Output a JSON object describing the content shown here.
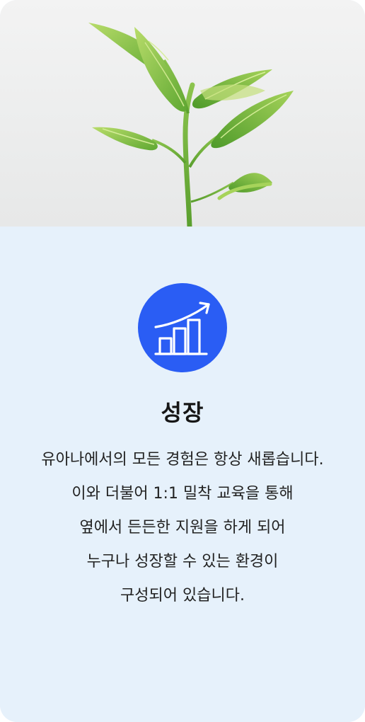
{
  "card": {
    "title": "성장",
    "description_lines": [
      "유아나에서의 모든 경험은 항상 새롭습니다.",
      "이와 더불어 1:1 밀착 교육을 통해",
      "옆에서 든든한 지원을 하게 되어",
      "누구나 성장할 수 있는 환경이",
      "구성되어 있습니다."
    ],
    "icon": "growth-chart-icon",
    "image": "plant-seedling-photo"
  },
  "colors": {
    "card_background": "#e6f1fb",
    "icon_background": "#2a5df4",
    "title_text": "#161616",
    "body_text": "#222222"
  }
}
